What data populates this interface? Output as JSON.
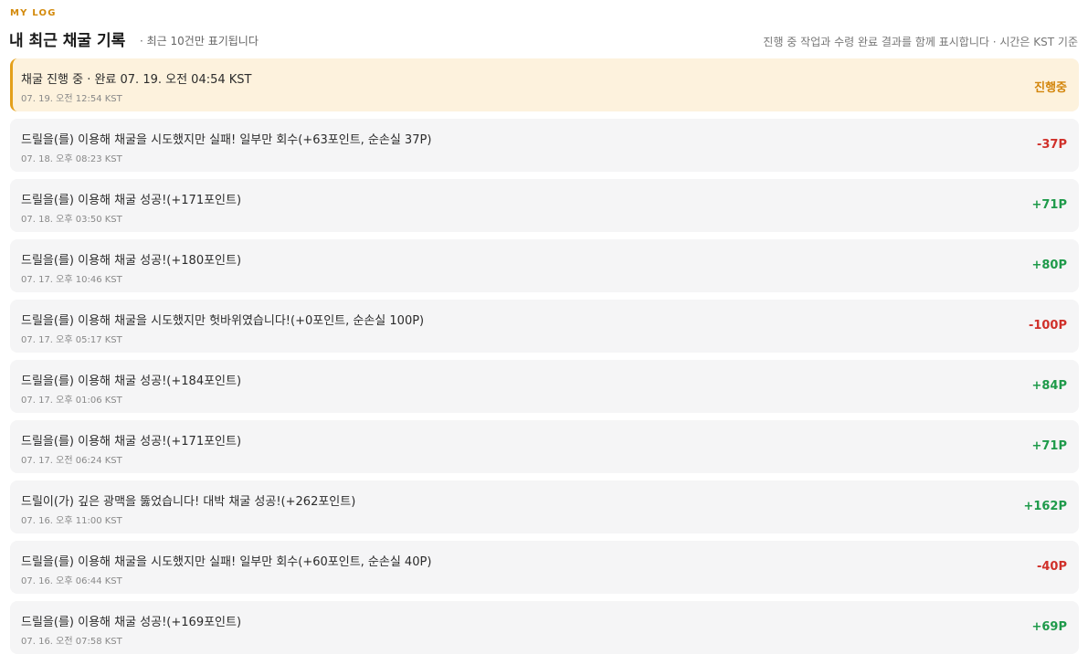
{
  "header": {
    "eyebrow": "MY LOG",
    "title": "내 최근 채굴 기록",
    "subtitle": "· 최근 10건만 표기됩니다",
    "note": "진행 중 작업과 수령 완료 결과를 함께 표시합니다 · 시간은 KST 기준"
  },
  "records": [
    {
      "message": "채굴 진행 중 · 완료 07. 19. 오전 04:54 KST",
      "time": "07. 19. 오전 12:54 KST",
      "amount": "진행중",
      "status": "pending"
    },
    {
      "message": "드릴을(를) 이용해 채굴을 시도했지만 실패! 일부만 회수(+63포인트, 순손실 37P)",
      "time": "07. 18. 오후 08:23 KST",
      "amount": "-37P",
      "status": "neg"
    },
    {
      "message": "드릴을(를) 이용해 채굴 성공!(+171포인트)",
      "time": "07. 18. 오후 03:50 KST",
      "amount": "+71P",
      "status": "pos"
    },
    {
      "message": "드릴을(를) 이용해 채굴 성공!(+180포인트)",
      "time": "07. 17. 오후 10:46 KST",
      "amount": "+80P",
      "status": "pos"
    },
    {
      "message": "드릴을(를) 이용해 채굴을 시도했지만 헛바위였습니다!(+0포인트, 순손실 100P)",
      "time": "07. 17. 오후 05:17 KST",
      "amount": "-100P",
      "status": "neg"
    },
    {
      "message": "드릴을(를) 이용해 채굴 성공!(+184포인트)",
      "time": "07. 17. 오후 01:06 KST",
      "amount": "+84P",
      "status": "pos"
    },
    {
      "message": "드릴을(를) 이용해 채굴 성공!(+171포인트)",
      "time": "07. 17. 오전 06:24 KST",
      "amount": "+71P",
      "status": "pos"
    },
    {
      "message": "드릴이(가) 깊은 광맥을 뚫었습니다! 대박 채굴 성공!(+262포인트)",
      "time": "07. 16. 오후 11:00 KST",
      "amount": "+162P",
      "status": "pos"
    },
    {
      "message": "드릴을(를) 이용해 채굴을 시도했지만 실패! 일부만 회수(+60포인트, 순손실 40P)",
      "time": "07. 16. 오후 06:44 KST",
      "amount": "-40P",
      "status": "neg"
    },
    {
      "message": "드릴을(를) 이용해 채굴 성공!(+169포인트)",
      "time": "07. 16. 오전 07:58 KST",
      "amount": "+69P",
      "status": "pos"
    }
  ],
  "colors": {
    "accent": "#d38a0c",
    "positive": "#1e9a4a",
    "negative": "#d0302a",
    "active_bg": "#fdf2dd"
  }
}
